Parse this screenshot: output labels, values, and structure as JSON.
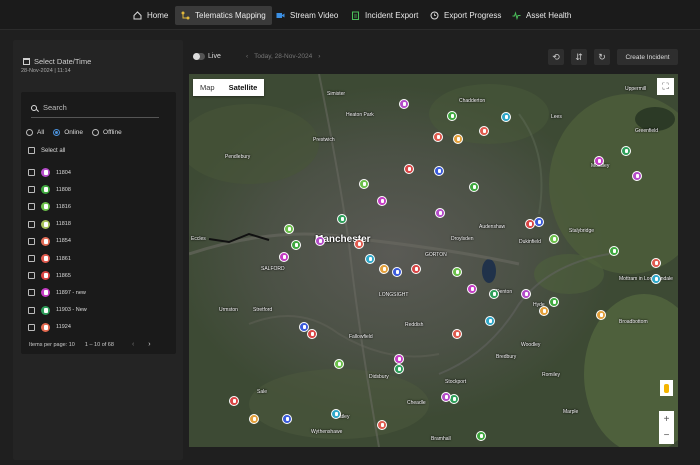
{
  "nav": {
    "items": [
      {
        "label": "Home",
        "icon": "home-icon"
      },
      {
        "label": "Telematics Mapping",
        "icon": "mapping-icon",
        "active": true
      },
      {
        "label": "Stream Video",
        "icon": "video-icon"
      },
      {
        "label": "Incident Export",
        "icon": "export-icon"
      },
      {
        "label": "Export Progress",
        "icon": "progress-icon"
      },
      {
        "label": "Asset Health",
        "icon": "health-icon"
      }
    ]
  },
  "filters": {
    "date_label": "Select Date/Time",
    "date_value": "28-Nov-2024 | 11:14",
    "search_placeholder": "Search",
    "status_options": [
      "All",
      "Online",
      "Offline"
    ],
    "status_selected": "Online",
    "select_all": "Select all"
  },
  "vehicles": [
    {
      "id": "11804",
      "color": "#b44cc9"
    },
    {
      "id": "11808",
      "color": "#3fa83f"
    },
    {
      "id": "11816",
      "color": "#6bbf4a"
    },
    {
      "id": "11818",
      "color": "#a7c15a"
    },
    {
      "id": "11854",
      "color": "#e06b55"
    },
    {
      "id": "11861",
      "color": "#e05b4f"
    },
    {
      "id": "11865",
      "color": "#d94545"
    },
    {
      "id": "11897 - new",
      "color": "#c43dc4"
    },
    {
      "id": "11903 - New",
      "color": "#2e9e5a"
    },
    {
      "id": "11924",
      "color": "#e36a50"
    }
  ],
  "pagination": {
    "items_per_page_label": "Items per page: 10",
    "range": "1 – 10 of 68"
  },
  "toolbar": {
    "live_label": "Live",
    "today_label": "Today, 28-Nov-2024",
    "create_label": "Create Incident"
  },
  "map": {
    "type_options": [
      "Map",
      "Satellite"
    ],
    "type_selected": "Satellite",
    "labels": {
      "manchester": "Manchester",
      "simister": "Simister",
      "prestwich": "Prestwich",
      "pendlebury": "Pendlebury",
      "eccles": "Eccles",
      "stretford": "Stretford",
      "sale": "Sale",
      "wythenshawe": "Wythenshawe",
      "stockport": "Stockport",
      "droylsden": "Droylsden",
      "audenshaw": "Audenshaw",
      "dukinfield": "Dukinfield",
      "stalybridge": "Stalybridge",
      "mossley": "Mossley",
      "denton": "Denton",
      "hyde": "Hyde",
      "bredbury": "Bredbury",
      "woodley": "Woodley",
      "romiley": "Romiley",
      "marple": "Marple",
      "broadbottom": "Broadbottom",
      "mottram": "Mottram in Longdendale",
      "chadderton": "Chadderton",
      "uppermill": "Uppermill",
      "greenfield": "Greenfield",
      "lees": "Lees",
      "longsight": "LONGSIGHT",
      "gorton": "GORTON",
      "fallowfield": "Fallowfield",
      "didsbury": "Didsbury",
      "cheadle": "Cheadle",
      "gatley": "Gatley",
      "bramhall": "Bramhall",
      "salford": "SALFORD",
      "urmston": "Urmston",
      "heaton": "Heaton Park",
      "reddish": "Reddish"
    }
  }
}
